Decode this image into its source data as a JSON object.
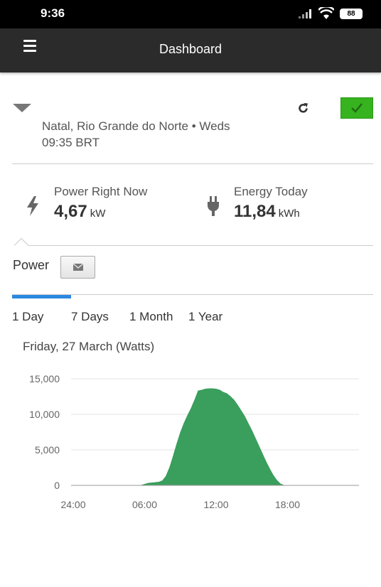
{
  "status_bar": {
    "time": "9:36",
    "battery": "88"
  },
  "app_bar": {
    "title": "Dashboard"
  },
  "site": {
    "location": "Natal, Rio Grande do Norte • Weds",
    "time": "09:35 BRT"
  },
  "kpis": {
    "power": {
      "label": "Power Right Now",
      "value": "4,67",
      "unit": "kW"
    },
    "energy": {
      "label": "Energy Today",
      "value": "11,84",
      "unit": "kWh"
    }
  },
  "power_section": {
    "title": "Power"
  },
  "range_tabs": [
    "1 Day",
    "7 Days",
    "1 Month",
    "1 Year"
  ],
  "active_tab": "1 Day",
  "colors": {
    "accent": "#2a89e0",
    "ok": "#36b31f",
    "chart_fill": "#3a9e5c",
    "app_bar": "#2b2b2b"
  },
  "chart_data": {
    "type": "area",
    "title": "Friday, 27 March (Watts)",
    "xlabel": "",
    "ylabel": "",
    "x_ticks": [
      "24:00",
      "06:00",
      "12:00",
      "18:00"
    ],
    "y_ticks": [
      "0",
      "5,000",
      "10,000",
      "15,000"
    ],
    "ylim": [
      0,
      15000
    ],
    "xlim_hours": [
      0,
      24
    ],
    "grid": true,
    "series": [
      {
        "x": [
          0,
          5.7,
          6.0,
          6.3,
          6.6,
          6.9,
          7.2,
          7.5,
          7.8,
          8.1,
          8.4,
          8.7,
          9.0,
          9.3,
          9.6,
          9.9,
          10.2,
          10.5,
          10.8,
          11.1,
          11.4,
          11.7,
          12.0,
          12.3,
          12.6,
          12.9,
          13.2,
          13.5,
          13.8,
          14.1,
          14.4,
          14.7,
          15.0,
          15.3,
          15.6,
          15.9,
          16.2,
          16.5,
          16.8,
          17.1,
          17.4,
          17.7,
          24
        ],
        "values": [
          0,
          0,
          150,
          300,
          350,
          400,
          450,
          650,
          1300,
          2500,
          4100,
          5800,
          7400,
          8700,
          9800,
          10800,
          12000,
          13300,
          13400,
          13550,
          13600,
          13600,
          13550,
          13400,
          13100,
          12900,
          12500,
          12000,
          11300,
          10500,
          9700,
          8700,
          7700,
          6600,
          5500,
          4400,
          3300,
          2300,
          1400,
          700,
          200,
          0,
          0
        ]
      }
    ]
  }
}
